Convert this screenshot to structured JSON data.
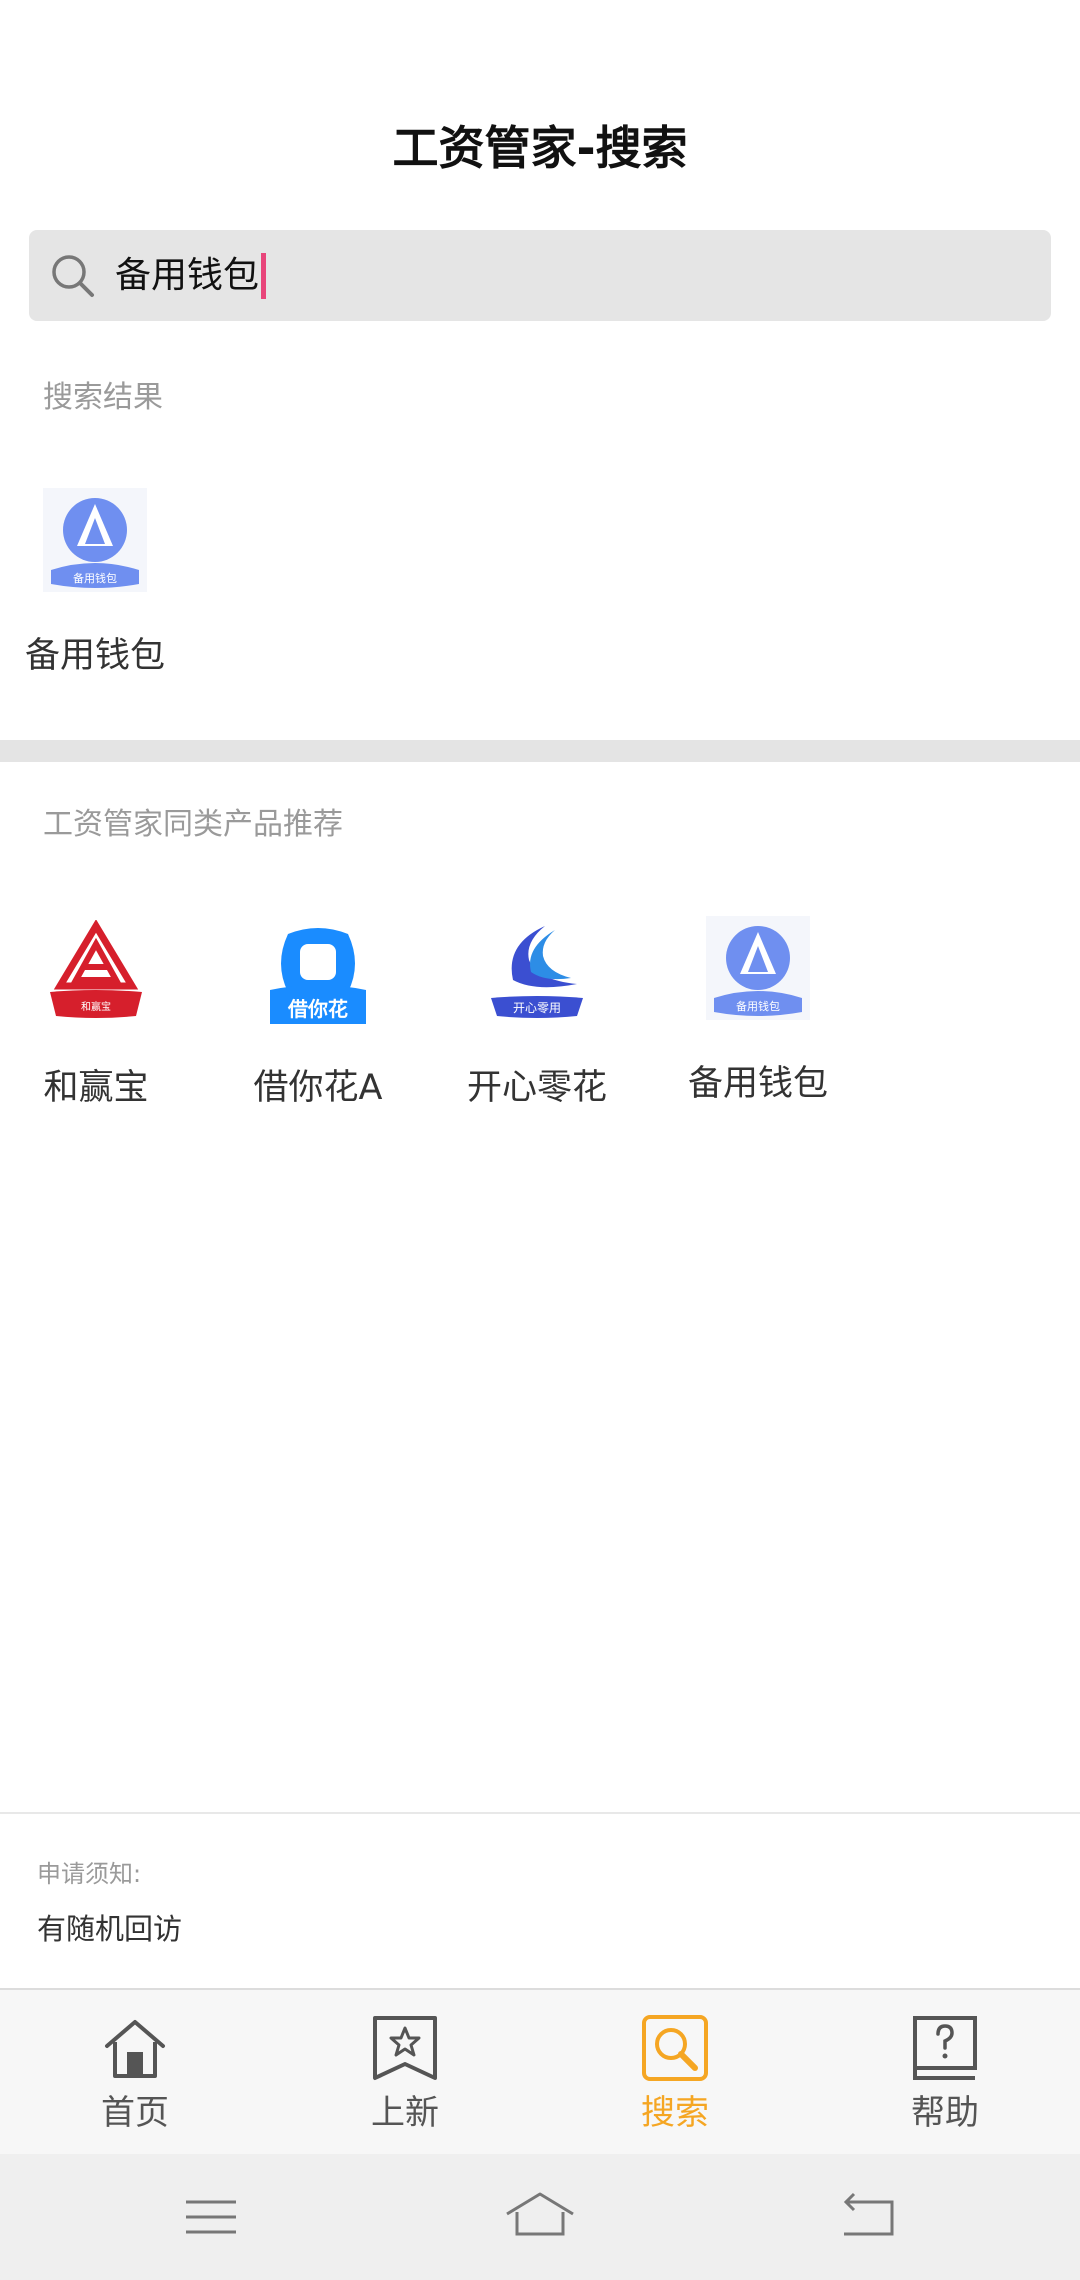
{
  "header": {
    "title": "工资管家-搜索"
  },
  "search": {
    "value": "备用钱包",
    "icon": "search-icon"
  },
  "results": {
    "label": "搜索结果",
    "items": [
      {
        "name": "备用钱包",
        "logo_text": "备用钱包",
        "color": "#6f8ff0"
      }
    ]
  },
  "recommend": {
    "label": "工资管家同类产品推荐",
    "items": [
      {
        "name": "和赢宝",
        "logo_text": "和赢宝",
        "color": "#d61f2c"
      },
      {
        "name": "借你花A",
        "logo_text": "借你花",
        "color": "#1a8cff"
      },
      {
        "name": "开心零花",
        "logo_text": "开心零用",
        "color": "#3b4fd1"
      },
      {
        "name": "备用钱包",
        "logo_text": "备用钱包",
        "color": "#6f8ff0"
      }
    ]
  },
  "notice": {
    "label": "申请须知:",
    "text": "有随机回访"
  },
  "tabbar": {
    "items": [
      {
        "label": "首页",
        "icon": "home-icon"
      },
      {
        "label": "上新",
        "icon": "star-bookmark-icon"
      },
      {
        "label": "搜索",
        "icon": "search-tab-icon",
        "active": true
      },
      {
        "label": "帮助",
        "icon": "help-icon"
      }
    ],
    "active_color": "#f5a623"
  },
  "system_nav": [
    "menu-icon",
    "home-nav-icon",
    "back-icon"
  ]
}
